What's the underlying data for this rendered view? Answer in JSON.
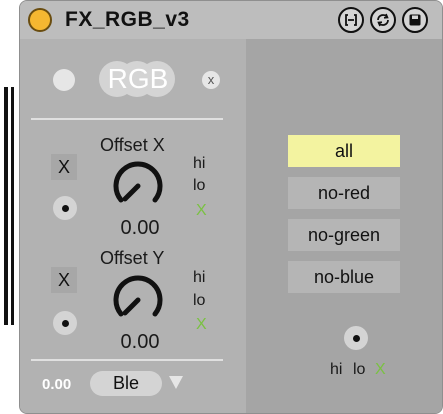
{
  "title": "FX_RGB_v3",
  "header_buttons": [
    {
      "icon": "bracket-box-icon"
    },
    {
      "icon": "refresh-icon"
    },
    {
      "icon": "save-icon"
    }
  ],
  "top": {
    "rgb_label": "RGB",
    "clear_label": "x"
  },
  "params": [
    {
      "label": "Offset X",
      "value": "0.00",
      "toggle": "X",
      "hi": "hi",
      "lo": "lo",
      "x": "X"
    },
    {
      "label": "Offset Y",
      "value": "0.00",
      "toggle": "X",
      "hi": "hi",
      "lo": "lo",
      "x": "X"
    }
  ],
  "bottom": {
    "value": "0.00",
    "menu": "Ble"
  },
  "modes": [
    "all",
    "no-red",
    "no-green",
    "no-blue"
  ],
  "active_mode": "all",
  "right_footer": {
    "hi": "hi",
    "lo": "lo",
    "x": "X"
  },
  "colors": {
    "accent": "#f5b731",
    "active_mode": "#f3f3a0",
    "green": "#7ac142"
  }
}
